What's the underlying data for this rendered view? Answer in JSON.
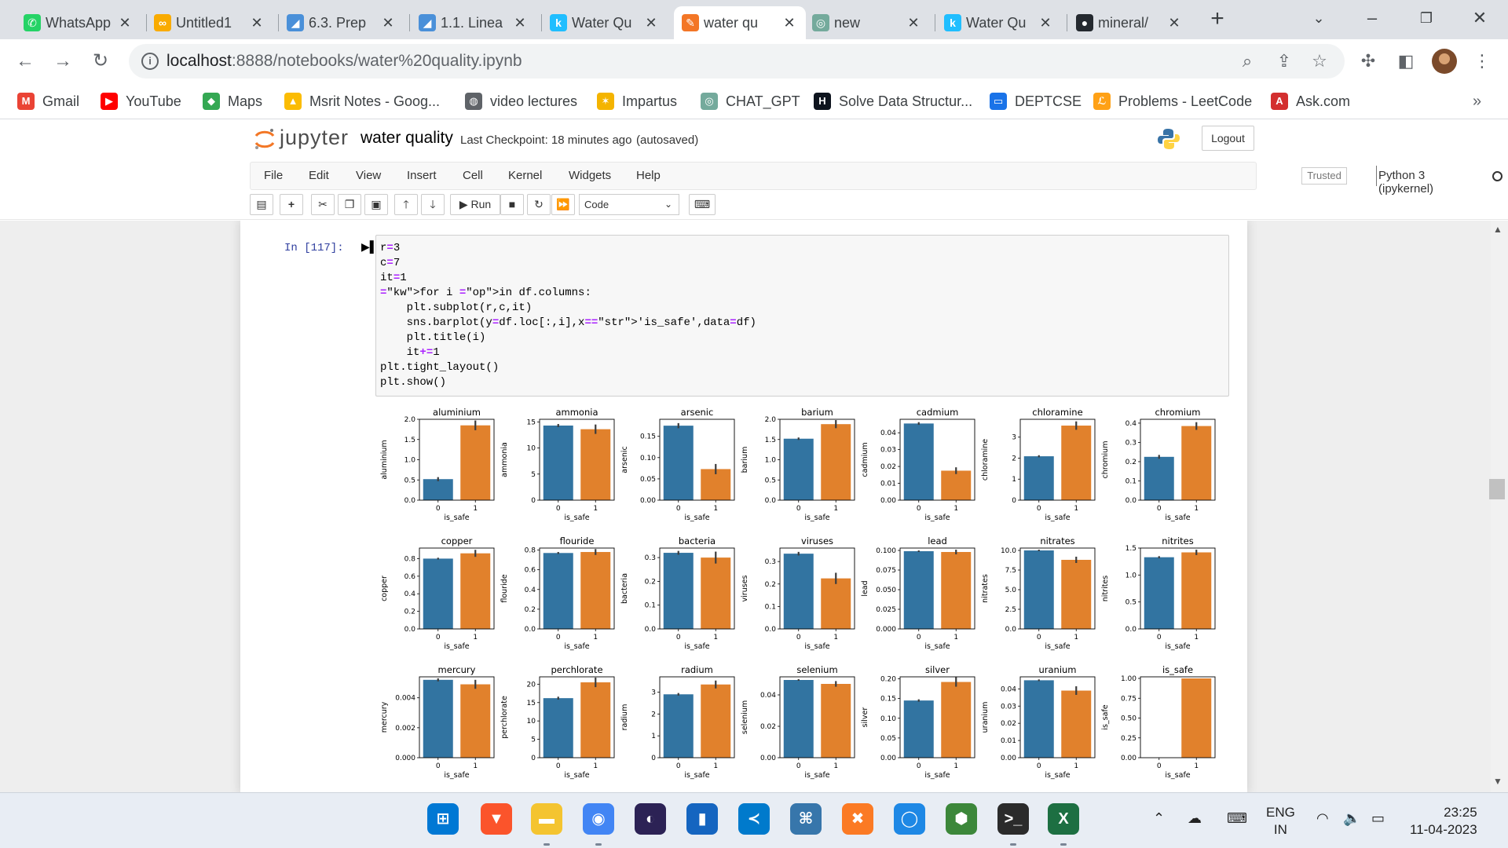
{
  "browser": {
    "tabs": [
      {
        "title": "WhatsApp",
        "favicon": "whatsapp-icon",
        "color": "#25d366",
        "glyph": "✆"
      },
      {
        "title": "Untitled1",
        "favicon": "colab-icon",
        "color": "#f9ab00",
        "glyph": "∞"
      },
      {
        "title": "6.3. Prep",
        "favicon": "d2l-icon",
        "color": "#4a90d9",
        "glyph": "◢"
      },
      {
        "title": "1.1. Linea",
        "favicon": "d2l-icon",
        "color": "#4a90d9",
        "glyph": "◢"
      },
      {
        "title": "Water Qu",
        "favicon": "kaggle-icon",
        "color": "#20beff",
        "glyph": "k"
      },
      {
        "title": "water qu",
        "favicon": "jupyter-icon",
        "color": "#f37626",
        "glyph": "✎",
        "active": true
      },
      {
        "title": "new",
        "favicon": "chatgpt-icon",
        "color": "#74aa9c",
        "glyph": "◎"
      },
      {
        "title": "Water Qu",
        "favicon": "kaggle-icon",
        "color": "#20beff",
        "glyph": "k"
      },
      {
        "title": "mineral/",
        "favicon": "github-icon",
        "color": "#24292f",
        "glyph": "●"
      }
    ],
    "url_host": "localhost",
    "url_rest": ":8888/notebooks/water%20quality.ipynb",
    "bookmarks": [
      {
        "label": "Gmail",
        "icon": "gmail-icon",
        "color": "#ea4335",
        "glyph": "M"
      },
      {
        "label": "YouTube",
        "icon": "youtube-icon",
        "color": "#ff0000",
        "glyph": "▶"
      },
      {
        "label": "Maps",
        "icon": "maps-icon",
        "color": "#34a853",
        "glyph": "◆"
      },
      {
        "label": "Msrit Notes - Goog...",
        "icon": "drive-icon",
        "color": "#fbbc04",
        "glyph": "▲"
      },
      {
        "label": "video lectures",
        "icon": "globe-icon",
        "color": "#5f6368",
        "glyph": "◍"
      },
      {
        "label": "Impartus",
        "icon": "impartus-icon",
        "color": "#f4b400",
        "glyph": "✶"
      },
      {
        "label": "CHAT_GPT",
        "icon": "chatgpt-icon",
        "color": "#74aa9c",
        "glyph": "◎"
      },
      {
        "label": "Solve Data Structur...",
        "icon": "hackerrank-icon",
        "color": "#0e141e",
        "glyph": "H"
      },
      {
        "label": "DEPTCSE",
        "icon": "dept-icon",
        "color": "#1a73e8",
        "glyph": "▭"
      },
      {
        "label": "Problems - LeetCode",
        "icon": "leetcode-icon",
        "color": "#ffa116",
        "glyph": "ℒ"
      },
      {
        "label": "Ask.com",
        "icon": "ask-icon",
        "color": "#d32f2f",
        "glyph": "A"
      }
    ]
  },
  "jupyter": {
    "brand": "jupyter",
    "notebook_name": "water quality",
    "checkpoint": "Last Checkpoint: 18 minutes ago",
    "saved_status": "(autosaved)",
    "logout": "Logout",
    "menus": [
      "File",
      "Edit",
      "View",
      "Insert",
      "Cell",
      "Kernel",
      "Widgets",
      "Help"
    ],
    "trusted": "Trusted",
    "kernel": "Python 3 (ipykernel)",
    "run_label": "Run",
    "cell_type": "Code",
    "prompt": "In [117]:",
    "code_lines": [
      "r=3",
      "c=7",
      "it=1",
      "for i in df.columns:",
      "    plt.subplot(r,c,it)",
      "    sns.barplot(y=df.loc[:,i],x='is_safe',data=df)",
      "    plt.title(i)",
      "    it+=1",
      "plt.tight_layout()",
      "plt.show()"
    ]
  },
  "chart_data": {
    "type": "bar",
    "colors": {
      "0": "#3274a1",
      "1": "#e1812c"
    },
    "xlabel": "is_safe",
    "categories": [
      "0",
      "1"
    ],
    "subplots": [
      {
        "title": "aluminium",
        "ylabel": "aluminium",
        "values": [
          0.52,
          1.85
        ],
        "err": [
          0.05,
          0.12
        ],
        "yticks": [
          "0.0",
          "0.5",
          "1.0",
          "1.5",
          "2.0"
        ],
        "ylim": [
          0,
          2.0
        ]
      },
      {
        "title": "ammonia",
        "ylabel": "ammonia",
        "values": [
          14.3,
          13.6
        ],
        "err": [
          0.3,
          0.9
        ],
        "yticks": [
          "0",
          "5",
          "10",
          "15"
        ],
        "ylim": [
          0,
          15.5
        ]
      },
      {
        "title": "arsenic",
        "ylabel": "arsenic",
        "values": [
          0.175,
          0.073
        ],
        "err": [
          0.006,
          0.012
        ],
        "yticks": [
          "0.00",
          "0.05",
          "0.10",
          "0.15"
        ],
        "ylim": [
          0,
          0.19
        ]
      },
      {
        "title": "barium",
        "ylabel": "barium",
        "values": [
          1.52,
          1.88
        ],
        "err": [
          0.03,
          0.1
        ],
        "yticks": [
          "0.0",
          "0.5",
          "1.0",
          "1.5",
          "2.0"
        ],
        "ylim": [
          0,
          2.0
        ]
      },
      {
        "title": "cadmium",
        "ylabel": "cadmium",
        "values": [
          0.0455,
          0.0175
        ],
        "err": [
          0.0008,
          0.002
        ],
        "yticks": [
          "0.00",
          "0.01",
          "0.02",
          "0.03",
          "0.04"
        ],
        "ylim": [
          0,
          0.048
        ]
      },
      {
        "title": "chloramine",
        "ylabel": "chloramine",
        "values": [
          2.09,
          3.55
        ],
        "err": [
          0.05,
          0.2
        ],
        "yticks": [
          "0",
          "1",
          "2",
          "3"
        ],
        "ylim": [
          0,
          3.85
        ]
      },
      {
        "title": "chromium",
        "ylabel": "chromium",
        "values": [
          0.225,
          0.385
        ],
        "err": [
          0.01,
          0.02
        ],
        "yticks": [
          "0.0",
          "0.1",
          "0.2",
          "0.3",
          "0.4"
        ],
        "ylim": [
          0,
          0.42
        ]
      },
      {
        "title": "copper",
        "ylabel": "copper",
        "values": [
          0.8,
          0.86
        ],
        "err": [
          0.01,
          0.04
        ],
        "yticks": [
          "0.0",
          "0.2",
          "0.4",
          "0.6",
          "0.8"
        ],
        "ylim": [
          0,
          0.92
        ]
      },
      {
        "title": "flouride",
        "ylabel": "flouride",
        "values": [
          0.77,
          0.78
        ],
        "err": [
          0.01,
          0.03
        ],
        "yticks": [
          "0.0",
          "0.2",
          "0.4",
          "0.6",
          "0.8"
        ],
        "ylim": [
          0,
          0.82
        ]
      },
      {
        "title": "bacteria",
        "ylabel": "bacteria",
        "values": [
          0.32,
          0.3
        ],
        "err": [
          0.008,
          0.025
        ],
        "yticks": [
          "0.0",
          "0.1",
          "0.2",
          "0.3"
        ],
        "ylim": [
          0,
          0.34
        ]
      },
      {
        "title": "viruses",
        "ylabel": "viruses",
        "values": [
          0.335,
          0.225
        ],
        "err": [
          0.008,
          0.025
        ],
        "yticks": [
          "0.0",
          "0.1",
          "0.2",
          "0.3"
        ],
        "ylim": [
          0,
          0.36
        ]
      },
      {
        "title": "lead",
        "ylabel": "lead",
        "values": [
          0.099,
          0.098
        ],
        "err": [
          0.001,
          0.003
        ],
        "yticks": [
          "0.000",
          "0.025",
          "0.050",
          "0.075",
          "0.100"
        ],
        "ylim": [
          0,
          0.103
        ]
      },
      {
        "title": "nitrates",
        "ylabel": "nitrates",
        "values": [
          10.0,
          8.8
        ],
        "err": [
          0.1,
          0.4
        ],
        "yticks": [
          "0.0",
          "2.5",
          "5.0",
          "7.5",
          "10.0"
        ],
        "ylim": [
          0,
          10.3
        ]
      },
      {
        "title": "nitrites",
        "ylabel": "nitrites",
        "values": [
          1.33,
          1.42
        ],
        "err": [
          0.02,
          0.05
        ],
        "yticks": [
          "0.0",
          "0.5",
          "1.0",
          "1.5"
        ],
        "ylim": [
          0,
          1.5
        ]
      },
      {
        "title": "mercury",
        "ylabel": "mercury",
        "values": [
          0.0052,
          0.0049
        ],
        "err": [
          0.0001,
          0.0003
        ],
        "yticks": [
          "0.000",
          "0.002",
          "0.004"
        ],
        "ylim": [
          0,
          0.0054
        ]
      },
      {
        "title": "perchlorate",
        "ylabel": "perchlorate",
        "values": [
          16.2,
          20.5
        ],
        "err": [
          0.4,
          1.3
        ],
        "yticks": [
          "0",
          "5",
          "10",
          "15",
          "20"
        ],
        "ylim": [
          0,
          22.0
        ]
      },
      {
        "title": "radium",
        "ylabel": "radium",
        "values": [
          2.9,
          3.35
        ],
        "err": [
          0.06,
          0.18
        ],
        "yticks": [
          "0",
          "1",
          "2",
          "3"
        ],
        "ylim": [
          0,
          3.7
        ]
      },
      {
        "title": "selenium",
        "ylabel": "selenium",
        "values": [
          0.0495,
          0.047
        ],
        "err": [
          0.0005,
          0.0018
        ],
        "yticks": [
          "0.00",
          "0.02",
          "0.04"
        ],
        "ylim": [
          0,
          0.0515
        ]
      },
      {
        "title": "silver",
        "ylabel": "silver",
        "values": [
          0.145,
          0.192
        ],
        "err": [
          0.003,
          0.012
        ],
        "yticks": [
          "0.00",
          "0.05",
          "0.10",
          "0.15",
          "0.20"
        ],
        "ylim": [
          0,
          0.205
        ]
      },
      {
        "title": "uranium",
        "ylabel": "uranium",
        "values": [
          0.045,
          0.039
        ],
        "err": [
          0.0005,
          0.0025
        ],
        "yticks": [
          "0.00",
          "0.01",
          "0.02",
          "0.03",
          "0.04"
        ],
        "ylim": [
          0,
          0.047
        ]
      },
      {
        "title": "is_safe",
        "ylabel": "is_safe",
        "values": [
          0.0,
          1.0
        ],
        "err": [
          0,
          0
        ],
        "yticks": [
          "0.00",
          "0.25",
          "0.50",
          "0.75",
          "1.00"
        ],
        "ylim": [
          0,
          1.02
        ]
      }
    ]
  },
  "taskbar": {
    "apps": [
      {
        "name": "windows-start-icon",
        "color": "#0078d4",
        "glyph": "⊞"
      },
      {
        "name": "brave-icon",
        "color": "#fb542b",
        "glyph": "▼"
      },
      {
        "name": "file-explorer-icon",
        "color": "#f4c430",
        "glyph": "▬"
      },
      {
        "name": "chrome-icon",
        "color": "#4285f4",
        "glyph": "◉"
      },
      {
        "name": "eclipse-icon",
        "color": "#2c2255",
        "glyph": "◐"
      },
      {
        "name": "app-blue-icon",
        "color": "#1565c0",
        "glyph": "▮"
      },
      {
        "name": "vscode-icon",
        "color": "#007acc",
        "glyph": "≺"
      },
      {
        "name": "python-idle-icon",
        "color": "#3776ab",
        "glyph": "⌘"
      },
      {
        "name": "xampp-icon",
        "color": "#fb7a24",
        "glyph": "✖"
      },
      {
        "name": "browser-blue-icon",
        "color": "#1e88e5",
        "glyph": "◯"
      },
      {
        "name": "nodejs-icon",
        "color": "#3c873a",
        "glyph": "⬢"
      },
      {
        "name": "terminal-icon",
        "color": "#2b2b2b",
        "glyph": ">_"
      },
      {
        "name": "excel-icon",
        "color": "#1d6f42",
        "glyph": "X"
      }
    ],
    "lang_top": "ENG",
    "lang_bottom": "IN",
    "time": "23:25",
    "date": "11-04-2023"
  }
}
